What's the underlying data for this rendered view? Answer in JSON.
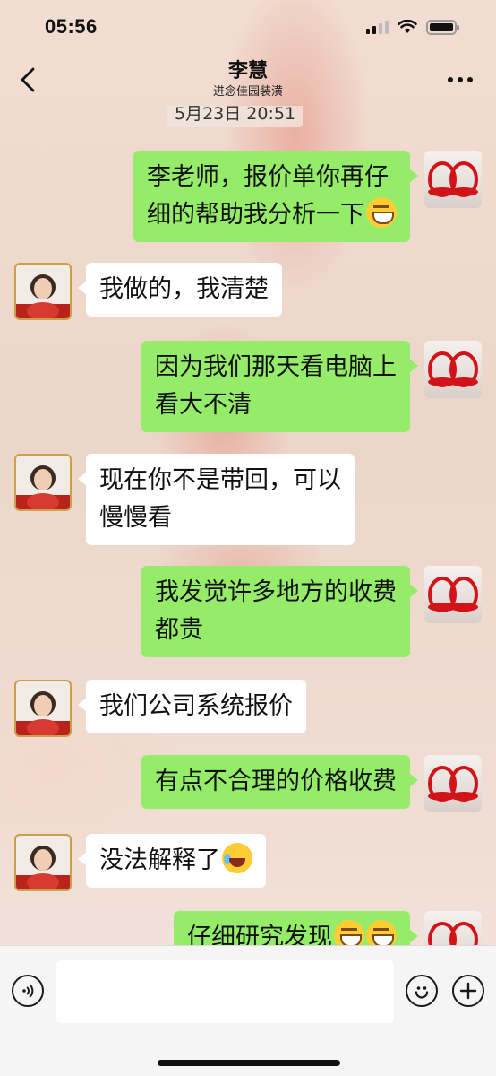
{
  "status_bar": {
    "time": "05:56"
  },
  "header": {
    "title": "李慧",
    "subtitle": "进念佳园装潢"
  },
  "chat": {
    "timestamp": "5月23日 20:51",
    "messages": [
      {
        "from": "me",
        "lines": [
          "李老师，报价单你再仔",
          "细的帮助我分析一下"
        ],
        "emoji": [
          "grin"
        ]
      },
      {
        "from": "other",
        "lines": [
          "我做的，我清楚"
        ]
      },
      {
        "from": "me",
        "lines": [
          "因为我们那天看电脑上",
          "看大不清"
        ]
      },
      {
        "from": "other",
        "lines": [
          "现在你不是带回，可以",
          "慢慢看"
        ]
      },
      {
        "from": "me",
        "lines": [
          "我发觉许多地方的收费",
          "都贵"
        ]
      },
      {
        "from": "other",
        "lines": [
          "我们公司系统报价"
        ]
      },
      {
        "from": "me",
        "lines": [
          "有点不合理的价格收费"
        ]
      },
      {
        "from": "other",
        "lines": [
          "没法解释了"
        ],
        "emoji": [
          "laugh"
        ]
      },
      {
        "from": "me",
        "lines": [
          "仔细研究发现"
        ],
        "emoji": [
          "grin",
          "grin"
        ]
      }
    ]
  },
  "input": {
    "placeholder": ""
  },
  "icons": {
    "back": "chevron-left-icon",
    "more": "more-dots-icon",
    "voice": "voice-icon",
    "emoji": "emoji-icon",
    "plus": "plus-icon"
  },
  "colors": {
    "my_bubble": "#95ec69",
    "their_bubble": "#ffffff",
    "input_bar": "#f5f5f5"
  }
}
